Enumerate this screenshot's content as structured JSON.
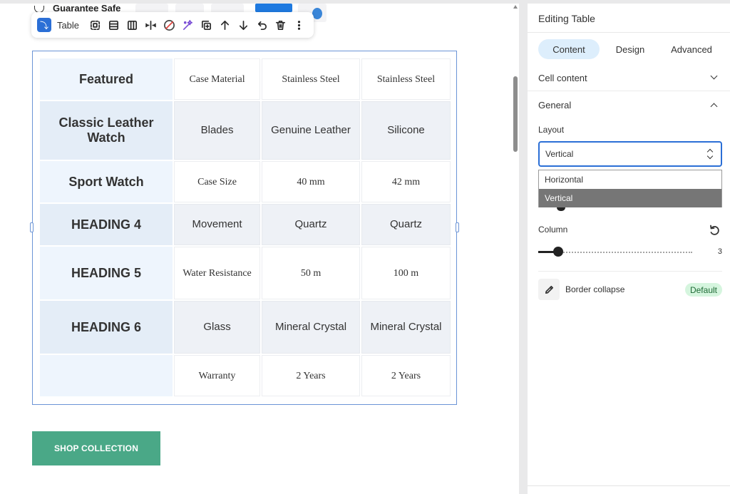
{
  "peek": {
    "guarantee_text": "Guarantee Safe"
  },
  "toolbar": {
    "element_label": "Table"
  },
  "table": {
    "rows": [
      {
        "heading": "Featured",
        "cells": [
          "Case Material",
          "Stainless Steel",
          "Stainless Steel"
        ],
        "font": "serif"
      },
      {
        "heading": "Classic Leather Watch",
        "cells": [
          "Blades",
          "Genuine Leather",
          "Silicone"
        ],
        "font": "sans"
      },
      {
        "heading": "Sport Watch",
        "cells": [
          "Case Size",
          "40 mm",
          "42 mm"
        ],
        "font": "serif"
      },
      {
        "heading": "HEADING 4",
        "cells": [
          "Movement",
          "Quartz",
          "Quartz"
        ],
        "font": "sans"
      },
      {
        "heading": "HEADING 5",
        "cells": [
          "Water Resistance",
          "50 m",
          "100 m"
        ],
        "font": "serif"
      },
      {
        "heading": "HEADING 6",
        "cells": [
          "Glass",
          "Mineral Crystal",
          "Mineral Crystal"
        ],
        "font": "sans"
      },
      {
        "heading": "",
        "cells": [
          "Warranty",
          "2 Years",
          "2 Years"
        ],
        "font": "serif"
      }
    ]
  },
  "shop_button": {
    "label": "SHOP COLLECTION"
  },
  "panel": {
    "title": "Editing Table",
    "tabs": [
      {
        "label": "Content",
        "active": true
      },
      {
        "label": "Design",
        "active": false
      },
      {
        "label": "Advanced",
        "active": false
      }
    ],
    "cell_content": {
      "title": "Cell content"
    },
    "general": {
      "title": "General",
      "layout_label": "Layout",
      "layout_value": "Vertical",
      "layout_options": [
        "Horizontal",
        "Vertical"
      ],
      "column_label": "Column",
      "column_value": "3",
      "border_collapse_label": "Border collapse",
      "border_collapse_badge": "Default"
    }
  },
  "colors": {
    "accent_blue": "#2b6fd6",
    "shop_button_green": "#4aa887",
    "active_tab_bg": "#ddeefc",
    "badge_green_bg": "#d5f5de"
  }
}
